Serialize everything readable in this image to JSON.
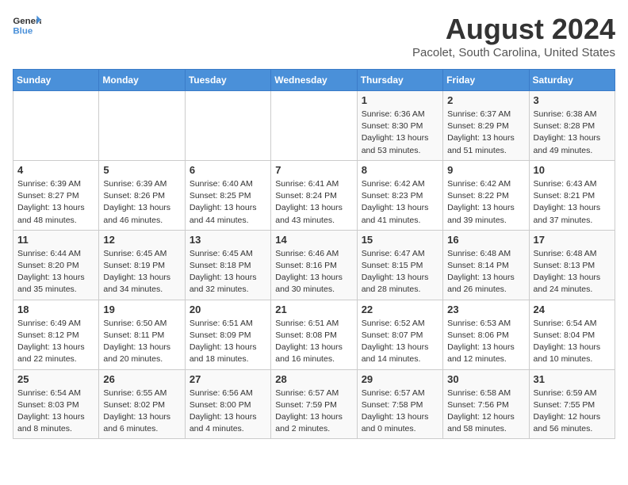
{
  "header": {
    "logo_text_general": "General",
    "logo_text_blue": "Blue",
    "month_year": "August 2024",
    "location": "Pacolet, South Carolina, United States"
  },
  "days_of_week": [
    "Sunday",
    "Monday",
    "Tuesday",
    "Wednesday",
    "Thursday",
    "Friday",
    "Saturday"
  ],
  "weeks": [
    [
      {
        "day": "",
        "info": ""
      },
      {
        "day": "",
        "info": ""
      },
      {
        "day": "",
        "info": ""
      },
      {
        "day": "",
        "info": ""
      },
      {
        "day": "1",
        "info": "Sunrise: 6:36 AM\nSunset: 8:30 PM\nDaylight: 13 hours\nand 53 minutes."
      },
      {
        "day": "2",
        "info": "Sunrise: 6:37 AM\nSunset: 8:29 PM\nDaylight: 13 hours\nand 51 minutes."
      },
      {
        "day": "3",
        "info": "Sunrise: 6:38 AM\nSunset: 8:28 PM\nDaylight: 13 hours\nand 49 minutes."
      }
    ],
    [
      {
        "day": "4",
        "info": "Sunrise: 6:39 AM\nSunset: 8:27 PM\nDaylight: 13 hours\nand 48 minutes."
      },
      {
        "day": "5",
        "info": "Sunrise: 6:39 AM\nSunset: 8:26 PM\nDaylight: 13 hours\nand 46 minutes."
      },
      {
        "day": "6",
        "info": "Sunrise: 6:40 AM\nSunset: 8:25 PM\nDaylight: 13 hours\nand 44 minutes."
      },
      {
        "day": "7",
        "info": "Sunrise: 6:41 AM\nSunset: 8:24 PM\nDaylight: 13 hours\nand 43 minutes."
      },
      {
        "day": "8",
        "info": "Sunrise: 6:42 AM\nSunset: 8:23 PM\nDaylight: 13 hours\nand 41 minutes."
      },
      {
        "day": "9",
        "info": "Sunrise: 6:42 AM\nSunset: 8:22 PM\nDaylight: 13 hours\nand 39 minutes."
      },
      {
        "day": "10",
        "info": "Sunrise: 6:43 AM\nSunset: 8:21 PM\nDaylight: 13 hours\nand 37 minutes."
      }
    ],
    [
      {
        "day": "11",
        "info": "Sunrise: 6:44 AM\nSunset: 8:20 PM\nDaylight: 13 hours\nand 35 minutes."
      },
      {
        "day": "12",
        "info": "Sunrise: 6:45 AM\nSunset: 8:19 PM\nDaylight: 13 hours\nand 34 minutes."
      },
      {
        "day": "13",
        "info": "Sunrise: 6:45 AM\nSunset: 8:18 PM\nDaylight: 13 hours\nand 32 minutes."
      },
      {
        "day": "14",
        "info": "Sunrise: 6:46 AM\nSunset: 8:16 PM\nDaylight: 13 hours\nand 30 minutes."
      },
      {
        "day": "15",
        "info": "Sunrise: 6:47 AM\nSunset: 8:15 PM\nDaylight: 13 hours\nand 28 minutes."
      },
      {
        "day": "16",
        "info": "Sunrise: 6:48 AM\nSunset: 8:14 PM\nDaylight: 13 hours\nand 26 minutes."
      },
      {
        "day": "17",
        "info": "Sunrise: 6:48 AM\nSunset: 8:13 PM\nDaylight: 13 hours\nand 24 minutes."
      }
    ],
    [
      {
        "day": "18",
        "info": "Sunrise: 6:49 AM\nSunset: 8:12 PM\nDaylight: 13 hours\nand 22 minutes."
      },
      {
        "day": "19",
        "info": "Sunrise: 6:50 AM\nSunset: 8:11 PM\nDaylight: 13 hours\nand 20 minutes."
      },
      {
        "day": "20",
        "info": "Sunrise: 6:51 AM\nSunset: 8:09 PM\nDaylight: 13 hours\nand 18 minutes."
      },
      {
        "day": "21",
        "info": "Sunrise: 6:51 AM\nSunset: 8:08 PM\nDaylight: 13 hours\nand 16 minutes."
      },
      {
        "day": "22",
        "info": "Sunrise: 6:52 AM\nSunset: 8:07 PM\nDaylight: 13 hours\nand 14 minutes."
      },
      {
        "day": "23",
        "info": "Sunrise: 6:53 AM\nSunset: 8:06 PM\nDaylight: 13 hours\nand 12 minutes."
      },
      {
        "day": "24",
        "info": "Sunrise: 6:54 AM\nSunset: 8:04 PM\nDaylight: 13 hours\nand 10 minutes."
      }
    ],
    [
      {
        "day": "25",
        "info": "Sunrise: 6:54 AM\nSunset: 8:03 PM\nDaylight: 13 hours\nand 8 minutes."
      },
      {
        "day": "26",
        "info": "Sunrise: 6:55 AM\nSunset: 8:02 PM\nDaylight: 13 hours\nand 6 minutes."
      },
      {
        "day": "27",
        "info": "Sunrise: 6:56 AM\nSunset: 8:00 PM\nDaylight: 13 hours\nand 4 minutes."
      },
      {
        "day": "28",
        "info": "Sunrise: 6:57 AM\nSunset: 7:59 PM\nDaylight: 13 hours\nand 2 minutes."
      },
      {
        "day": "29",
        "info": "Sunrise: 6:57 AM\nSunset: 7:58 PM\nDaylight: 13 hours\nand 0 minutes."
      },
      {
        "day": "30",
        "info": "Sunrise: 6:58 AM\nSunset: 7:56 PM\nDaylight: 12 hours\nand 58 minutes."
      },
      {
        "day": "31",
        "info": "Sunrise: 6:59 AM\nSunset: 7:55 PM\nDaylight: 12 hours\nand 56 minutes."
      }
    ]
  ]
}
